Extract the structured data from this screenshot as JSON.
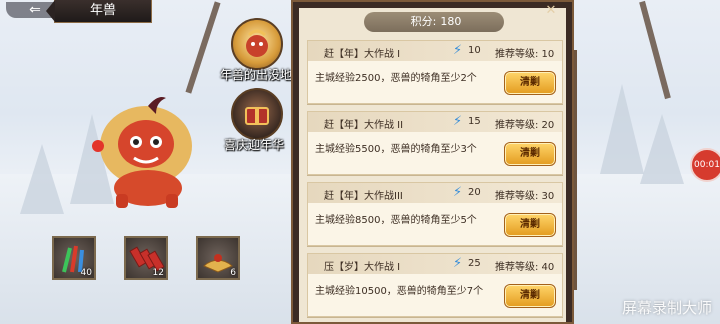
{
  "header": {
    "back_icon": "back-arrow-icon",
    "title": "年兽"
  },
  "side_buttons": [
    {
      "label": "年兽的出没地",
      "icon": "nian-beast-icon"
    },
    {
      "label": "喜庆迎年华",
      "icon": "gift-chest-icon"
    }
  ],
  "items": [
    {
      "icon": "firework-icon",
      "count": "40"
    },
    {
      "icon": "firecracker-icon",
      "count": "12"
    },
    {
      "icon": "fan-icon",
      "count": "6"
    }
  ],
  "panel": {
    "score_label": "积分:",
    "score_value": "180",
    "cards": [
      {
        "name": "赶【年】大作战 I",
        "energy": "10",
        "recommend": "推荐等级: 10",
        "desc": "主城经验2500，恶兽的犄角至少2个",
        "button": "清剿"
      },
      {
        "name": "赶【年】大作战 II",
        "energy": "15",
        "recommend": "推荐等级: 20",
        "desc": "主城经验5500，恶兽的犄角至少3个",
        "button": "清剿"
      },
      {
        "name": "赶【年】大作战III",
        "energy": "20",
        "recommend": "推荐等级: 30",
        "desc": "主城经验8500，恶兽的犄角至少5个",
        "button": "清剿"
      },
      {
        "name": "压【岁】大作战 I",
        "energy": "25",
        "recommend": "推荐等级: 40",
        "desc": "主城经验10500，恶兽的犄角至少7个",
        "button": "清剿"
      }
    ]
  },
  "record_badge": "00:01",
  "watermark": "屏幕录制大师"
}
